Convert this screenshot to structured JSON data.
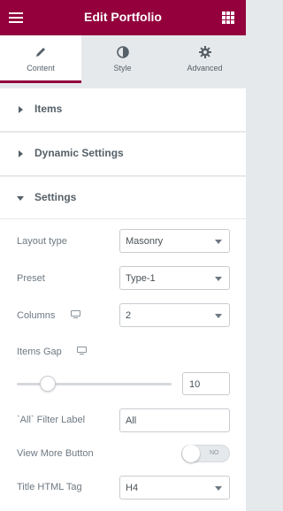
{
  "header": {
    "title": "Edit Portfolio",
    "menu_icon": "hamburger-menu-icon",
    "apps_icon": "grid-apps-icon"
  },
  "tabs": [
    {
      "label": "Content",
      "icon": "pencil-icon",
      "active": true
    },
    {
      "label": "Style",
      "icon": "half-circle-icon",
      "active": false
    },
    {
      "label": "Advanced",
      "icon": "gear-icon",
      "active": false
    }
  ],
  "sections": {
    "items": "Items",
    "dynamic": "Dynamic Settings",
    "settings": "Settings"
  },
  "settings": {
    "layout_type": {
      "label": "Layout type",
      "value": "Masonry"
    },
    "preset": {
      "label": "Preset",
      "value": "Type-1"
    },
    "columns": {
      "label": "Columns",
      "value": "2"
    },
    "items_gap": {
      "label": "Items Gap",
      "value": "10"
    },
    "filter_label": {
      "label": "`All` Filter Label",
      "value": "All"
    },
    "view_more": {
      "label": "View More Button",
      "state": "NO"
    },
    "title_tag": {
      "label": "Title HTML Tag",
      "value": "H4"
    }
  },
  "colors": {
    "brand": "#93003c",
    "panel": "#e6e9ec"
  }
}
